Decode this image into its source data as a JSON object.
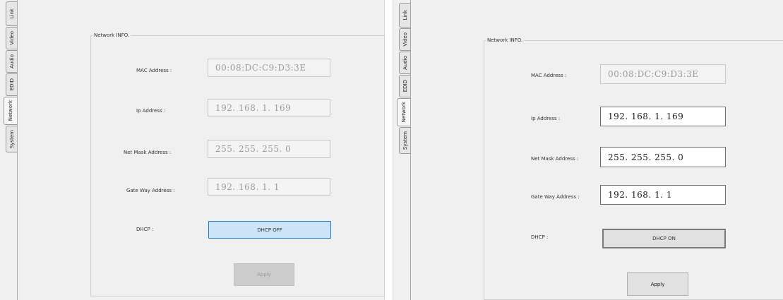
{
  "tabs": [
    "Link",
    "Video",
    "Audio",
    "EDID",
    "Network",
    "System"
  ],
  "active_tab": "Network",
  "left_panel": {
    "group_title": "Network INFO.",
    "mac_label": "MAC Address :",
    "mac_value": "00:08:DC:C9:D3:3E",
    "ip_label": "Ip Address :",
    "ip_value": "192. 168. 1. 169",
    "netmask_label": "Net Mask Address :",
    "netmask_value": "255. 255. 255. 0",
    "gateway_label": "Gate Way Address :",
    "gateway_value": "192. 168. 1. 1",
    "dhcp_label": "DHCP :",
    "dhcp_button": "DHCP OFF",
    "apply_button": "Apply"
  },
  "right_panel": {
    "group_title": "Network INFO.",
    "mac_label": "MAC Address :",
    "mac_value": "00:08:DC:C9:D3:3E",
    "ip_label": "Ip Address :",
    "ip_value": "192. 168. 1. 169",
    "netmask_label": "Net Mask Address :",
    "netmask_value": "255. 255. 255. 0",
    "gateway_label": "Gate Way Address :",
    "gateway_value": "192. 168. 1. 1",
    "dhcp_label": "DHCP :",
    "dhcp_button": "DHCP ON",
    "apply_button": "Apply"
  }
}
